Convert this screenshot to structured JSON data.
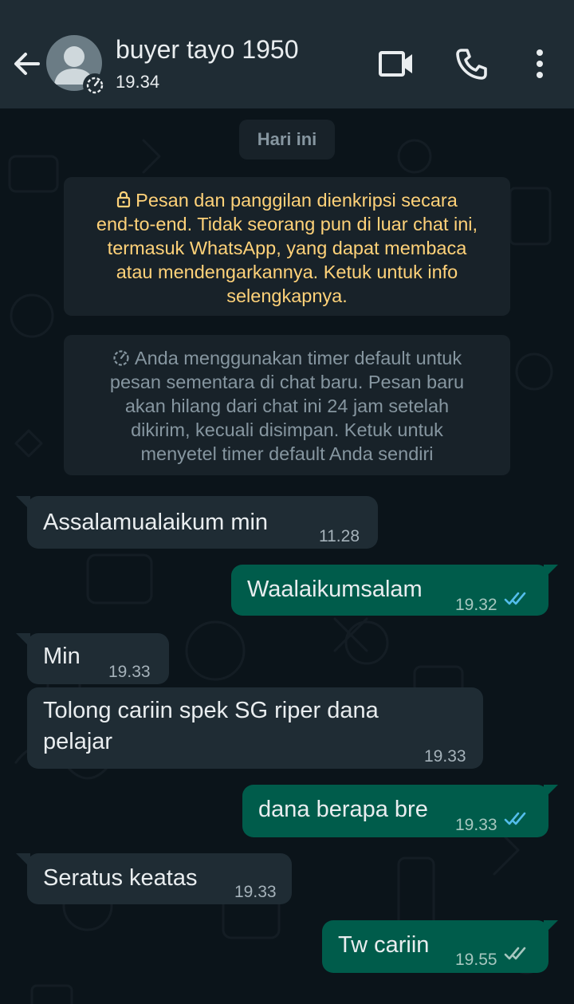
{
  "header": {
    "contact_name": "buyer tayo 1950",
    "last_seen": "19.34",
    "icons": [
      "back-arrow-icon",
      "avatar-placeholder-icon",
      "disappearing-timer-icon",
      "video-call-icon",
      "voice-call-icon",
      "more-options-icon"
    ]
  },
  "chat": {
    "date_chip": "Hari ini",
    "encryption_notice": {
      "icon": "lock-icon",
      "lines": [
        "Pesan dan panggilan dienkripsi secara",
        "end-to-end. Tidak seorang pun di luar chat ini,",
        "termasuk WhatsApp, yang dapat membaca",
        "atau mendengarkannya. Ketuk untuk info",
        "selengkapnya."
      ]
    },
    "timer_notice": {
      "icon": "timer-icon",
      "lines": [
        "Anda menggunakan timer default untuk",
        "pesan sementara di chat baru. Pesan baru",
        "akan hilang dari chat ini 24 jam setelah",
        "dikirim, kecuali disimpan. Ketuk untuk",
        "menyetel timer default Anda sendiri"
      ]
    },
    "messages": [
      {
        "direction": "in",
        "text": "Assalamualaikum min",
        "time": "11.28"
      },
      {
        "direction": "out",
        "text": "Waalaikumsalam",
        "time": "19.32",
        "status": "read"
      },
      {
        "direction": "in",
        "text": "Min",
        "time": "19.33"
      },
      {
        "direction": "in",
        "text_lines": [
          "Tolong cariin spek SG riper dana",
          "pelajar"
        ],
        "time": "19.33"
      },
      {
        "direction": "out",
        "text": "dana berapa bre",
        "time": "19.33",
        "status": "read"
      },
      {
        "direction": "in",
        "text": "Seratus keatas",
        "time": "19.33"
      },
      {
        "direction": "out",
        "text": "Tw cariin",
        "time": "19.55",
        "status": "delivered"
      }
    ]
  },
  "colors": {
    "header_bg": "#1f2c34",
    "chat_bg": "#0b141a",
    "incoming_bubble": "#1f2c34",
    "outgoing_bubble": "#005c4b",
    "system_text": "#ffd279",
    "read_ticks": "#53bdeb",
    "delivered_ticks": "#a6c7bf"
  }
}
